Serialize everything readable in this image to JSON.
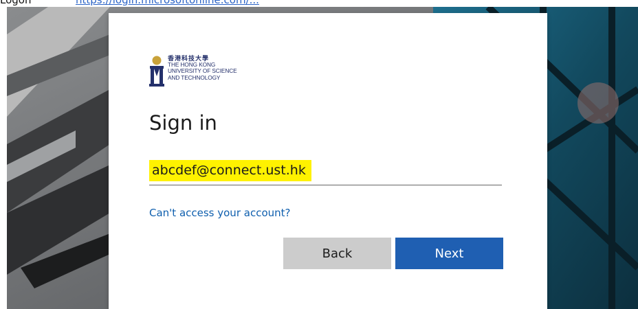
{
  "page": {
    "caption": "Logon",
    "caption_link": "https://login.microsoftonline.com/..."
  },
  "logo": {
    "chinese_name": "香港科技大學",
    "english_lines": [
      "THE HONG KONG",
      "UNIVERSITY OF SCIENCE",
      "AND TECHNOLOGY"
    ]
  },
  "form": {
    "title": "Sign in",
    "email_value": "abcdef@connect.ust.hk",
    "cant_access_link": "Can't access your account?",
    "back_label": "Back",
    "next_label": "Next"
  },
  "colors": {
    "accent": "#1f5fb2",
    "highlight": "#fff200",
    "link": "#0f5fae"
  }
}
